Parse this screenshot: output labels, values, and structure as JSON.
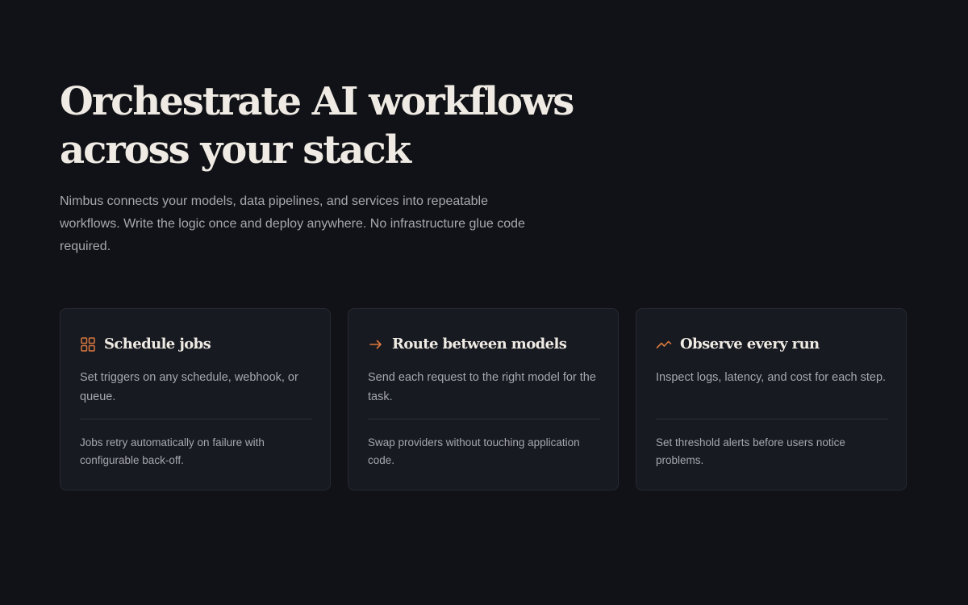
{
  "hero": {
    "title_line1": "Orchestrate AI workflows",
    "title_line2": "across your stack",
    "description": "Nimbus connects your models, data pipelines, and services into repeatable workflows. Write the logic once and deploy anywhere. No infrastructure glue code required."
  },
  "theme": {
    "background": "#111217",
    "card_background": "#181a21",
    "card_border": "#262932",
    "accent": "#d9773e",
    "heading_color": "#efebe4",
    "body_color": "#a6a8ae"
  },
  "features": [
    {
      "icon": "grid-icon",
      "title": "Schedule jobs",
      "description": "Set triggers on any schedule, webhook, or queue.",
      "note": "Jobs retry automatically on failure with configurable back-off."
    },
    {
      "icon": "arrow-right-icon",
      "title": "Route between models",
      "description": "Send each request to the right model for the task.",
      "note": "Swap providers without touching application code."
    },
    {
      "icon": "trend-icon",
      "title": "Observe every run",
      "description": "Inspect logs, latency, and cost for each step.",
      "note": "Set threshold alerts before users notice problems."
    }
  ]
}
